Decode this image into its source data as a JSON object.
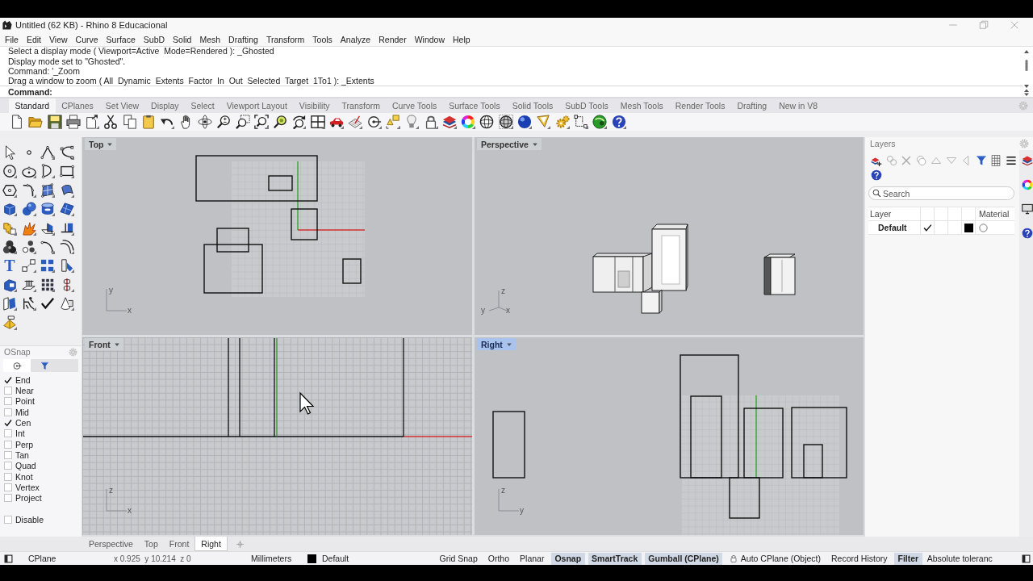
{
  "window": {
    "title": "Untitled (62 KB) - Rhino 8 Educacional"
  },
  "menu": [
    "File",
    "Edit",
    "View",
    "Curve",
    "Surface",
    "SubD",
    "Solid",
    "Mesh",
    "Drafting",
    "Transform",
    "Tools",
    "Analyze",
    "Render",
    "Window",
    "Help"
  ],
  "command_history": [
    "Select a display mode ( Viewport=Active  Mode=Rendered ): _Ghosted",
    "Display mode set to \"Ghosted\".",
    "Command: '_Zoom",
    "Drag a window to zoom ( All  Dynamic  Extents  Factor  In  Out  Selected  Target  1To1 ): _Extents"
  ],
  "command_prompt": "Command:",
  "toolbar_tabs": [
    {
      "label": "Standard",
      "selected": true
    },
    {
      "label": "CPlanes",
      "selected": false
    },
    {
      "label": "Set View",
      "selected": false
    },
    {
      "label": "Display",
      "selected": false
    },
    {
      "label": "Select",
      "selected": false
    },
    {
      "label": "Viewport Layout",
      "selected": false
    },
    {
      "label": "Visibility",
      "selected": false
    },
    {
      "label": "Transform",
      "selected": false
    },
    {
      "label": "Curve Tools",
      "selected": false
    },
    {
      "label": "Surface Tools",
      "selected": false
    },
    {
      "label": "Solid Tools",
      "selected": false
    },
    {
      "label": "SubD Tools",
      "selected": false
    },
    {
      "label": "Mesh Tools",
      "selected": false
    },
    {
      "label": "Render Tools",
      "selected": false
    },
    {
      "label": "Drafting",
      "selected": false
    },
    {
      "label": "New in V8",
      "selected": false
    }
  ],
  "left_toolbar": {
    "text_tool_glyph": "T"
  },
  "osnap": {
    "title": "OSnap",
    "tabs": [
      {
        "selected": true
      },
      {
        "selected": false
      }
    ],
    "options": [
      {
        "label": "End",
        "checked": true
      },
      {
        "label": "Near",
        "checked": false
      },
      {
        "label": "Point",
        "checked": false
      },
      {
        "label": "Mid",
        "checked": false
      },
      {
        "label": "Cen",
        "checked": true
      },
      {
        "label": "Int",
        "checked": false
      },
      {
        "label": "Perp",
        "checked": false
      },
      {
        "label": "Tan",
        "checked": false
      },
      {
        "label": "Quad",
        "checked": false
      },
      {
        "label": "Knot",
        "checked": false
      },
      {
        "label": "Vertex",
        "checked": false
      },
      {
        "label": "Project",
        "checked": false
      }
    ],
    "disable": {
      "label": "Disable",
      "checked": false
    }
  },
  "viewports": [
    {
      "name": "Top",
      "kind": "top",
      "selected": false,
      "axis_labels": [
        "y",
        "x"
      ]
    },
    {
      "name": "Perspective",
      "kind": "perspective",
      "selected": false,
      "axis_labels": [
        "z",
        "y",
        "x"
      ]
    },
    {
      "name": "Front",
      "kind": "front",
      "selected": false,
      "axis_labels": [
        "z",
        "x"
      ]
    },
    {
      "name": "Right",
      "kind": "right",
      "selected": true,
      "axis_labels": [
        "z",
        "y"
      ]
    }
  ],
  "viewport_tabs": [
    {
      "label": "Perspective",
      "selected": false
    },
    {
      "label": "Top",
      "selected": false
    },
    {
      "label": "Front",
      "selected": false
    },
    {
      "label": "Right",
      "selected": true
    }
  ],
  "layers_panel": {
    "title": "Layers",
    "search": {
      "placeholder": "Search"
    },
    "columns": [
      "Layer",
      "Material"
    ],
    "layers": [
      {
        "name": "Default",
        "current": true,
        "color": "#000000"
      }
    ]
  },
  "status_bar": {
    "cplane": "CPlane",
    "coordinates": "x 0.925  y 10.214  z 0",
    "units": "Millimeters",
    "layer": {
      "name": "Default",
      "color": "#000000"
    },
    "toggles": [
      {
        "label": "Grid Snap",
        "on": false,
        "kind": "plain"
      },
      {
        "label": "Ortho",
        "on": false,
        "kind": "plain"
      },
      {
        "label": "Planar",
        "on": false,
        "kind": "plain"
      },
      {
        "label": "Osnap",
        "on": true,
        "kind": "plain"
      },
      {
        "label": "SmartTrack",
        "on": true,
        "kind": "plain"
      },
      {
        "label": "Gumball (CPlane)",
        "on": true,
        "kind": "plain"
      },
      {
        "label": "Auto CPlane (Object)",
        "on": false,
        "kind": "locked"
      },
      {
        "label": "Record History",
        "on": false,
        "kind": "plain"
      },
      {
        "label": "Filter",
        "on": true,
        "kind": "plain"
      }
    ],
    "tolerance": "Absolute toleranc"
  }
}
